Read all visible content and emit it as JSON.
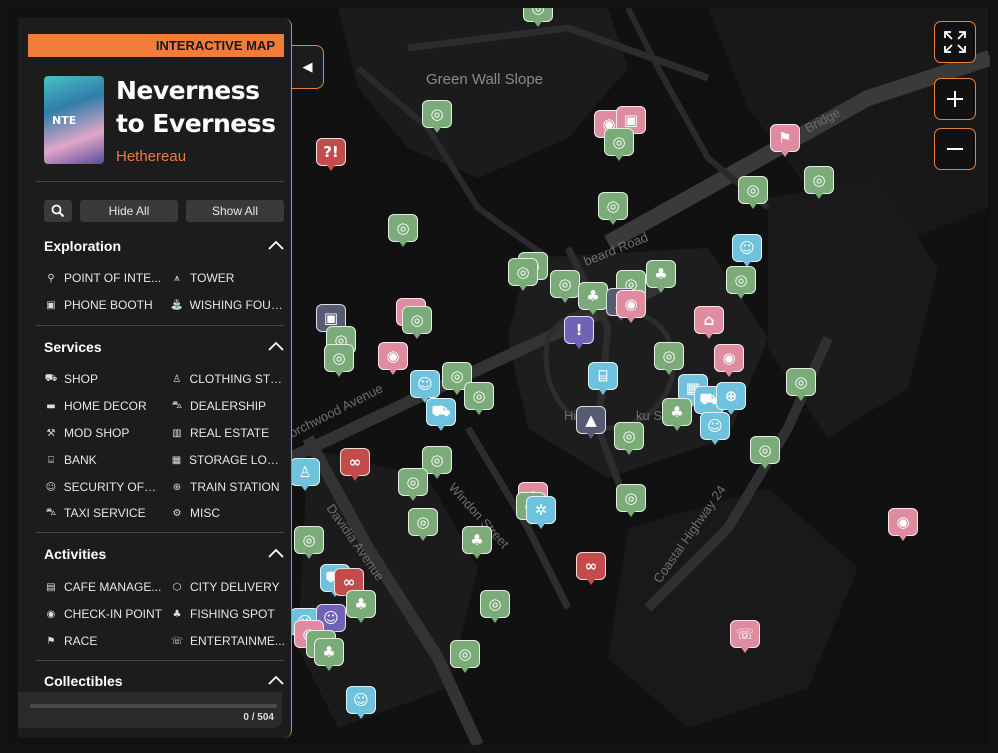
{
  "badge": "INTERACTIVE MAP",
  "game": {
    "title": "Neverness to Everness",
    "cover_text": "NTE",
    "region": "Hethereau"
  },
  "toolbar": {
    "search_icon": "search-icon",
    "hide_all": "Hide All",
    "show_all": "Show All"
  },
  "sections": [
    {
      "title": "Exploration",
      "items": [
        {
          "label": "POINT OF INTE...",
          "icon": "pin-icon"
        },
        {
          "label": "TOWER",
          "icon": "tower-icon"
        },
        {
          "label": "PHONE BOOTH",
          "icon": "phone-booth-icon"
        },
        {
          "label": "WISHING FOUN...",
          "icon": "fountain-icon"
        }
      ]
    },
    {
      "title": "Services",
      "items": [
        {
          "label": "SHOP",
          "icon": "cart-icon"
        },
        {
          "label": "CLOTHING STO...",
          "icon": "shirt-icon"
        },
        {
          "label": "HOME DECOR",
          "icon": "sofa-icon"
        },
        {
          "label": "DEALERSHIP",
          "icon": "car-icon"
        },
        {
          "label": "MOD SHOP",
          "icon": "wrench-icon"
        },
        {
          "label": "REAL ESTATE",
          "icon": "building-icon"
        },
        {
          "label": "BANK",
          "icon": "bank-icon"
        },
        {
          "label": "STORAGE LOCK...",
          "icon": "locker-icon"
        },
        {
          "label": "SECURITY OFFI...",
          "icon": "shield-icon"
        },
        {
          "label": "TRAIN STATION",
          "icon": "train-icon"
        },
        {
          "label": "TAXI SERVICE",
          "icon": "taxi-icon"
        },
        {
          "label": "MISC",
          "icon": "gear-icon"
        }
      ]
    },
    {
      "title": "Activities",
      "items": [
        {
          "label": "CAFE MANAGE...",
          "icon": "cafe-icon"
        },
        {
          "label": "CITY DELIVERY",
          "icon": "delivery-icon"
        },
        {
          "label": "CHECK-IN POINT",
          "icon": "camera-icon"
        },
        {
          "label": "FISHING SPOT",
          "icon": "fish-icon"
        },
        {
          "label": "RACE",
          "icon": "flag-icon"
        },
        {
          "label": "ENTERTAINME...",
          "icon": "ticket-icon"
        }
      ]
    },
    {
      "title": "Collectibles",
      "items": []
    }
  ],
  "progress": {
    "text": "0 / 504",
    "fraction": 0
  },
  "map": {
    "streets": [
      "Green Wall Slope",
      "Bridge",
      "beard Road",
      "orchwood Avenue",
      "Davidia Avenue",
      "Windon Street",
      "Coastal Highway 24",
      "Hi",
      "ku Str"
    ]
  },
  "controls": {
    "fullscreen_icon": "fullscreen-icon",
    "zoom_in_icon": "plus-icon",
    "zoom_out_icon": "minus-icon",
    "collapse_icon": "arrow-left-icon"
  },
  "marker_colors": {
    "oracle": "#7bab79",
    "checkin": "#e08ca0",
    "shop": "#6fc2dd",
    "event": "#c44b4b",
    "quest": "#6e63b6",
    "tower": "#565b72",
    "accent": "#f07c3b"
  }
}
